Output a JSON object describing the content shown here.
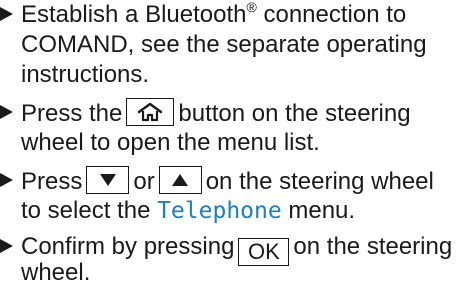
{
  "steps": [
    {
      "lines": [
        {
          "before": "Establish a Bluetooth",
          "sup": "®",
          "after": " connection to"
        },
        "COMAND, see the separate operating",
        "instructions."
      ]
    },
    {
      "lines": [
        {
          "before": "Press the",
          "after": "button on the steering"
        },
        "wheel to open the menu list."
      ],
      "key_icon": "home-icon"
    },
    {
      "lines": [
        {
          "before": "Press",
          "mid": "or",
          "after": "on the steering wheel"
        },
        {
          "before": "to select the ",
          "highlight": "Telephone",
          "after": " menu."
        }
      ],
      "key_icons": [
        "arrow-down-icon",
        "arrow-up-icon"
      ]
    },
    {
      "lines": [
        {
          "before": "Confirm by pressing",
          "key": "OK",
          "after": "on the steering"
        },
        "wheel."
      ]
    }
  ],
  "colors": {
    "text": "#1a1a1a",
    "highlight": "#1a7fc4"
  }
}
